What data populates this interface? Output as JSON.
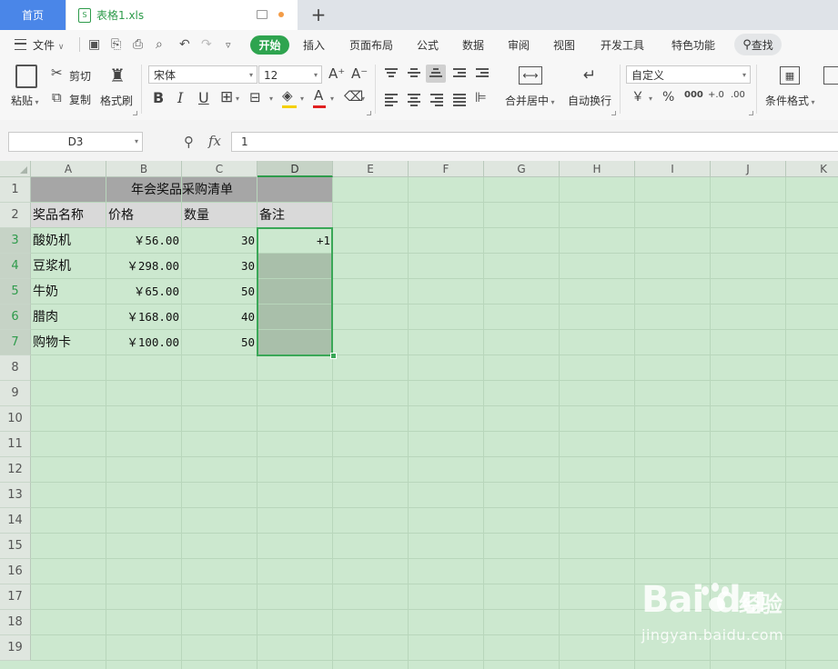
{
  "tabs": {
    "home_label": "首页",
    "file_label": "表格1.xls",
    "file_icon_letter": "S",
    "add_label": "+"
  },
  "menu": {
    "file_label": "文件",
    "items": [
      "开始",
      "插入",
      "页面布局",
      "公式",
      "数据",
      "审阅",
      "视图",
      "开发工具",
      "特色功能"
    ],
    "search_label": "查找"
  },
  "ribbon": {
    "paste": "粘贴",
    "cut": "剪切",
    "copy": "复制",
    "format_painter": "格式刷",
    "font_name": "宋体",
    "font_size": "12",
    "bold": "B",
    "italic": "I",
    "underline": "U",
    "font_color_glyph": "A",
    "merge_center": "合并居中",
    "wrap_text": "自动换行",
    "number_format": "自定义",
    "currency_glyph": "￥",
    "percent_glyph": "%",
    "thousands_glyph": "000",
    "dec_inc_glyph": "+.0",
    "dec_dec_glyph": ".00",
    "conditional_format": "条件格式",
    "grow_font": "A⁺",
    "shrink_font": "A⁻"
  },
  "formula_bar": {
    "cell_ref": "D3",
    "fx_label": "fx",
    "content": "1"
  },
  "sheet": {
    "columns": [
      "A",
      "B",
      "C",
      "D",
      "E",
      "F",
      "G",
      "H",
      "I",
      "J",
      "K"
    ],
    "selected_column": "D",
    "rows": [
      "1",
      "2",
      "3",
      "4",
      "5",
      "6",
      "7",
      "8",
      "9",
      "10",
      "11",
      "12",
      "13",
      "14",
      "15",
      "16",
      "17",
      "18",
      "19"
    ],
    "title": "年会奖品采购清单",
    "headers": [
      "奖品名称",
      "价格",
      "数量",
      "备注"
    ],
    "data": [
      {
        "name": "酸奶机",
        "price": "￥56.00",
        "qty": "30",
        "note": "+1"
      },
      {
        "name": "豆浆机",
        "price": "￥298.00",
        "qty": "30",
        "note": ""
      },
      {
        "name": "牛奶",
        "price": "￥65.00",
        "qty": "50",
        "note": ""
      },
      {
        "name": "腊肉",
        "price": "￥168.00",
        "qty": "40",
        "note": ""
      },
      {
        "name": "购物卡",
        "price": "￥100.00",
        "qty": "50",
        "note": ""
      }
    ]
  },
  "watermark": {
    "logo": "Bai  du",
    "cn": "经验",
    "url": "jingyan.baidu.com"
  },
  "colors": {
    "sheet_bg": "#cce8cf",
    "accent_green": "#2ea44f",
    "home_tab_blue": "#4a86e8",
    "title_band": "#a6a6a6",
    "header_band": "#d9d9d9"
  }
}
